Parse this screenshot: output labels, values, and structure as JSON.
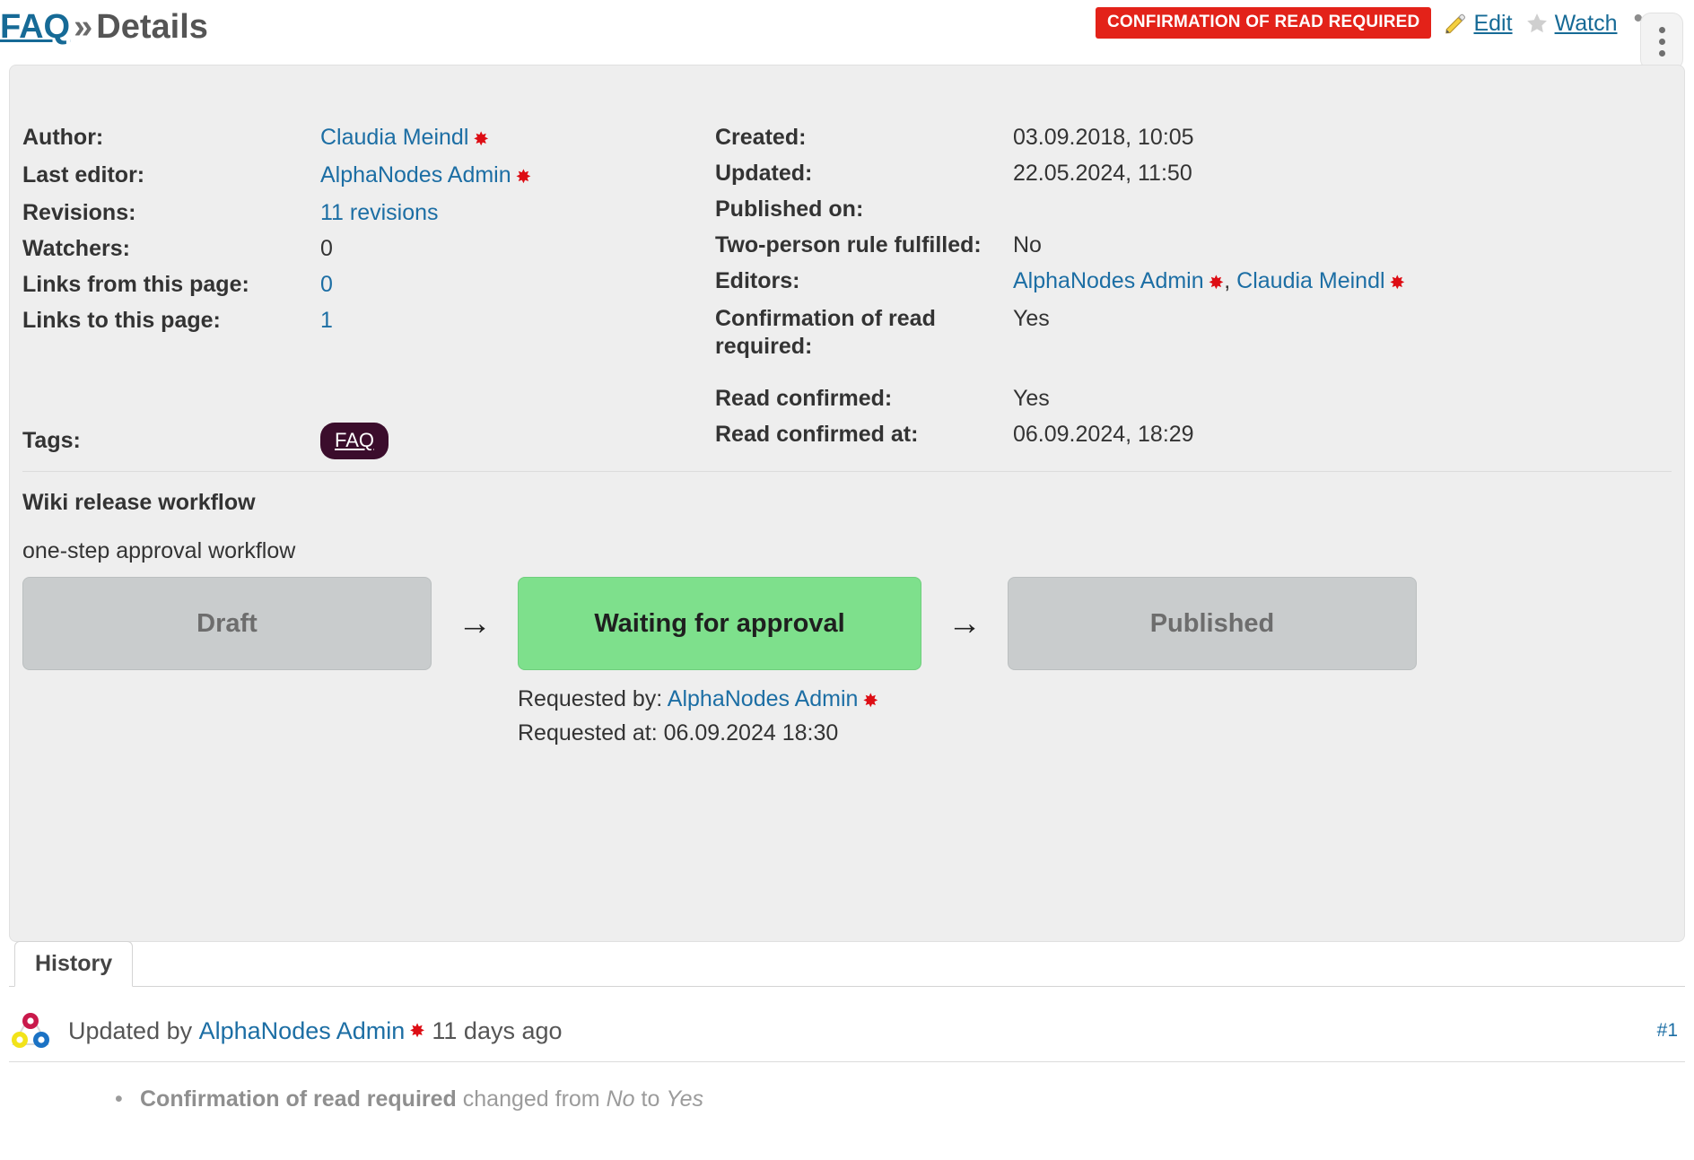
{
  "header": {
    "breadcrumb_root": "FAQ",
    "breadcrumb_separator": "»",
    "breadcrumb_current": "Details",
    "badge_label": "CONFIRMATION OF READ REQUIRED",
    "edit_label": "Edit",
    "watch_label": "Watch",
    "more_label": "•••",
    "badge_color": "#e32219",
    "link_color": "#166a96"
  },
  "details": {
    "left": [
      {
        "label": "Author:",
        "value": "Claudia Meindl",
        "link": true,
        "gear": true
      },
      {
        "label": "Last editor:",
        "value": "AlphaNodes Admin",
        "link": true,
        "gear": true
      },
      {
        "label": "Revisions:",
        "value": "11 revisions",
        "link": true,
        "gear": false
      },
      {
        "label": "Watchers:",
        "value": "0",
        "link": false,
        "gear": false
      },
      {
        "label": "Links from this page:",
        "value": "0",
        "link": true,
        "gear": false
      },
      {
        "label": "Links to this page:",
        "value": "1",
        "link": true,
        "gear": false
      }
    ],
    "right": [
      {
        "label": "Created:",
        "value": "03.09.2018, 10:05"
      },
      {
        "label": "Updated:",
        "value": "22.05.2024, 11:50"
      },
      {
        "label": "Published on:",
        "value": ""
      },
      {
        "label": "Two-person rule fulfilled:",
        "value": "No"
      },
      {
        "label": "Editors:",
        "value": "AlphaNodes Admin, Claudia Meindl"
      },
      {
        "label": "Confirmation of read required:",
        "value": "Yes"
      },
      {
        "label": "Read confirmed:",
        "value": "Yes"
      },
      {
        "label": "Read confirmed at:",
        "value": "06.09.2024, 18:29"
      }
    ],
    "editors": [
      {
        "name": "AlphaNodes Admin",
        "gear": true
      },
      {
        "name": "Claudia Meindl",
        "gear": true
      }
    ],
    "editors_separator": ",",
    "tags_label": "Tags:",
    "tags": [
      "FAQ"
    ],
    "tag_color": "#3b0d2c"
  },
  "workflow": {
    "title": "Wiki release workflow",
    "subtitle": "one-step approval workflow",
    "steps": [
      {
        "label": "Draft",
        "state": "inactive"
      },
      {
        "label": "Waiting for approval",
        "state": "active"
      },
      {
        "label": "Published",
        "state": "inactive"
      }
    ],
    "arrow": "→",
    "requested_by_label": "Requested by:",
    "requested_by_user": "AlphaNodes Admin",
    "requested_at_label": "Requested at:",
    "requested_at_value": "06.09.2024 18:30",
    "active_color": "#7ee08c",
    "inactive_color": "#c9cccd"
  },
  "tabs": [
    {
      "label": "History",
      "active": true
    }
  ],
  "history": {
    "entries": [
      {
        "prefix": "Updated by",
        "user": "AlphaNodes Admin",
        "time": "11 days",
        "suffix": "ago",
        "anchor": "#1",
        "changes": [
          {
            "field": "Confirmation of read required",
            "text": "changed from",
            "from": "No",
            "to": "to",
            "to_value": "Yes"
          }
        ]
      }
    ]
  }
}
